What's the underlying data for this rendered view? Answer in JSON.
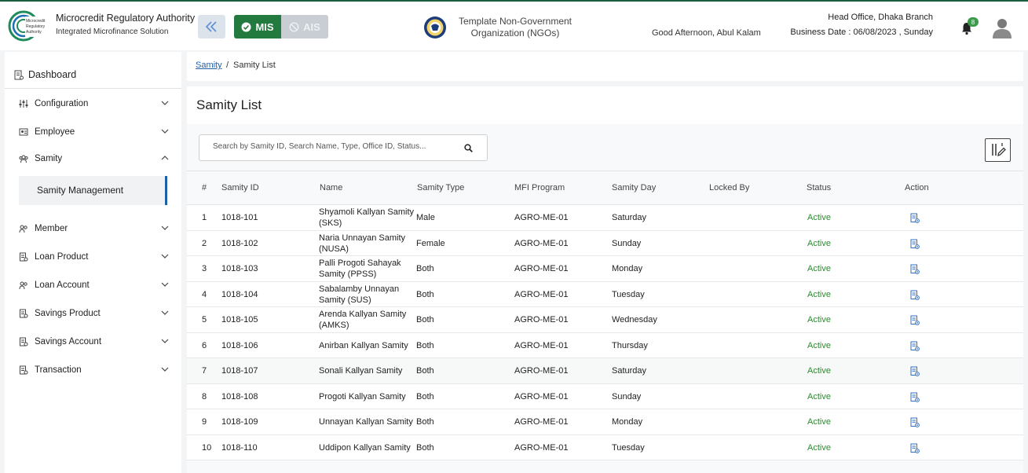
{
  "header": {
    "brand_title": "Microcredit Regulatory Authority",
    "brand_subtitle": "Integrated Microfinance Solution",
    "logo_text": "Microcredit Regulatory Authority",
    "mis_label": "MIS",
    "ais_label": "AIS",
    "org_name_line1": "Template Non-Government",
    "org_name_line2": "Organization (NGOs)",
    "greeting": "Good Afternoon, Abul Kalam",
    "branch": "Head Office, Dhaka Branch",
    "business_date": "Business Date : 06/08/2023 , Sunday",
    "notification_count": "8",
    "accent_color": "#237a3e"
  },
  "sidebar": {
    "dashboard": "Dashboard",
    "items": [
      {
        "label": "Configuration",
        "icon": "sliders-icon",
        "expanded": false
      },
      {
        "label": "Employee",
        "icon": "id-card-icon",
        "expanded": false
      },
      {
        "label": "Samity",
        "icon": "group-icon",
        "expanded": true
      },
      {
        "label": "Member",
        "icon": "users-icon",
        "expanded": false
      },
      {
        "label": "Loan Product",
        "icon": "document-icon",
        "expanded": false
      },
      {
        "label": "Loan Account",
        "icon": "users-icon",
        "expanded": false
      },
      {
        "label": "Savings Product",
        "icon": "document-icon",
        "expanded": false
      },
      {
        "label": "Savings Account",
        "icon": "document-icon",
        "expanded": false
      },
      {
        "label": "Transaction",
        "icon": "document-icon",
        "expanded": false
      }
    ],
    "active_sub": "Samity Management"
  },
  "breadcrumb": {
    "link": "Samity",
    "separator": "/",
    "current": "Samity List"
  },
  "main": {
    "title": "Samity List",
    "search_placeholder": "Search by Samity ID, Search Name, Type, Office ID, Status..."
  },
  "table": {
    "columns": [
      "#",
      "Samity ID",
      "Name",
      "Samity Type",
      "MFI Program",
      "Samity Day",
      "Locked By",
      "Status",
      "Action"
    ],
    "rows": [
      {
        "n": "1",
        "id": "1018-101",
        "name1": "Shyamoli Kallyan Samity",
        "name2": "(SKS)",
        "type": "Male",
        "program": "AGRO-ME-01",
        "day": "Saturday",
        "locked": "",
        "status": "Active"
      },
      {
        "n": "2",
        "id": "1018-102",
        "name1": "Naria Unnayan Samity",
        "name2": "(NUSA)",
        "type": "Female",
        "program": "AGRO-ME-01",
        "day": "Sunday",
        "locked": "",
        "status": "Active"
      },
      {
        "n": "3",
        "id": "1018-103",
        "name1": "Palli Progoti Sahayak",
        "name2": "Samity (PPSS)",
        "type": "Both",
        "program": "AGRO-ME-01",
        "day": "Monday",
        "locked": "",
        "status": "Active"
      },
      {
        "n": "4",
        "id": "1018-104",
        "name1": "Sabalamby Unnayan",
        "name2": "Samity (SUS)",
        "type": "Both",
        "program": "AGRO-ME-01",
        "day": "Tuesday",
        "locked": "",
        "status": "Active"
      },
      {
        "n": "5",
        "id": "1018-105",
        "name1": "Arenda Kallyan Samity",
        "name2": "(AMKS)",
        "type": "Both",
        "program": "AGRO-ME-01",
        "day": "Wednesday",
        "locked": "",
        "status": "Active"
      },
      {
        "n": "6",
        "id": "1018-106",
        "name1": "Anirban Kallyan Samity",
        "name2": "",
        "type": "Both",
        "program": "AGRO-ME-01",
        "day": "Thursday",
        "locked": "",
        "status": "Active"
      },
      {
        "n": "7",
        "id": "1018-107",
        "name1": "Sonali Kallyan Samity",
        "name2": "",
        "type": "Both",
        "program": "AGRO-ME-01",
        "day": "Saturday",
        "locked": "",
        "status": "Active"
      },
      {
        "n": "8",
        "id": "1018-108",
        "name1": "Progoti Kallyan Samity",
        "name2": "",
        "type": "Both",
        "program": "AGRO-ME-01",
        "day": "Sunday",
        "locked": "",
        "status": "Active"
      },
      {
        "n": "9",
        "id": "1018-109",
        "name1": "Unnayan Kallyan Samity",
        "name2": "",
        "type": "Both",
        "program": "AGRO-ME-01",
        "day": "Monday",
        "locked": "",
        "status": "Active"
      },
      {
        "n": "10",
        "id": "1018-110",
        "name1": "Uddipon Kallyan Samity",
        "name2": "",
        "type": "Both",
        "program": "AGRO-ME-01",
        "day": "Tuesday",
        "locked": "",
        "status": "Active"
      }
    ]
  }
}
